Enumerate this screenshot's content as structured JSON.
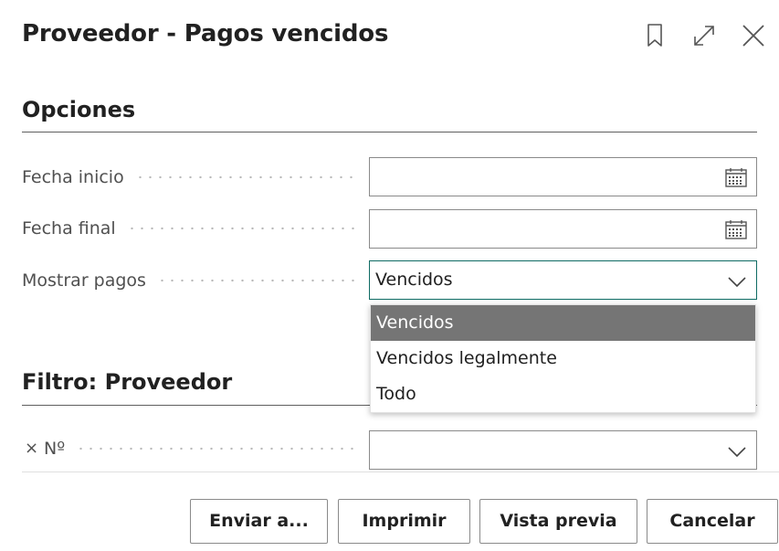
{
  "dialog": {
    "title": "Proveedor - Pagos vencidos"
  },
  "options": {
    "section_title": "Opciones",
    "fecha_inicio": {
      "label": "Fecha inicio",
      "value": ""
    },
    "fecha_final": {
      "label": "Fecha final",
      "value": ""
    },
    "mostrar_pagos": {
      "label": "Mostrar pagos",
      "value": "Vencidos",
      "options": [
        "Vencidos",
        "Vencidos legalmente",
        "Todo"
      ]
    }
  },
  "filter": {
    "section_title": "Filtro: Proveedor",
    "no_field": {
      "label": "Nº",
      "remove_glyph": "×",
      "value": ""
    }
  },
  "buttons": {
    "send": "Enviar a...",
    "print": "Imprimir",
    "preview": "Vista previa",
    "cancel": "Cancelar"
  },
  "colors": {
    "focus_border": "#0e6b63",
    "selected_option_bg": "#757575"
  }
}
